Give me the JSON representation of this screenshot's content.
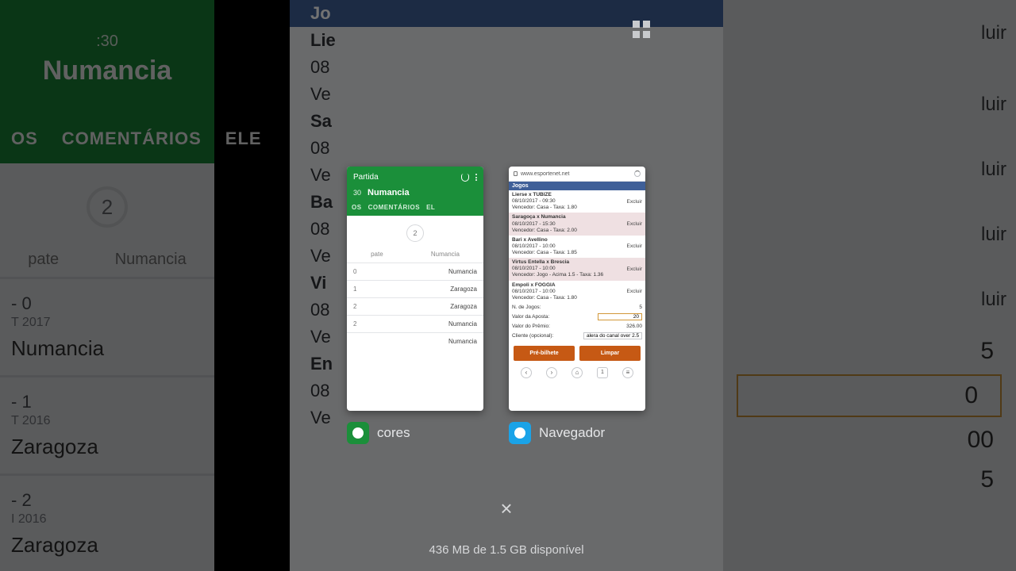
{
  "bg_left": {
    "time_fragment": ":30",
    "team": "Numancia",
    "tabs_fragment_left": "OS",
    "tab_comments": "COMENTÁRIOS",
    "tabs_fragment_right": "ELE",
    "circle_value": "2",
    "sub_label": "pate",
    "team_below": "Numancia",
    "history": [
      {
        "score": "- 0",
        "date": "T 2017",
        "opp": "Numancia"
      },
      {
        "score": "- 1",
        "date": "T 2016",
        "opp": "Zaragoza"
      },
      {
        "score": "- 2",
        "date": "I 2016",
        "opp": "Zaragoza"
      }
    ]
  },
  "bg_center": {
    "rows": [
      {
        "t": "Jo"
      },
      {
        "t": "Lie",
        "d": "08",
        "v": "Ve"
      },
      {
        "t": "Sa",
        "d": "08",
        "v": "Ve"
      },
      {
        "t": "Ba",
        "d": "08",
        "v": "Ve"
      },
      {
        "t": "Vi",
        "d": "08",
        "v": "Ve"
      },
      {
        "t": "En",
        "d": "08",
        "v": "Ve"
      }
    ]
  },
  "bg_right": {
    "rows": [
      {
        "excl": "luir"
      },
      {
        "excl": "luir"
      },
      {
        "excl": "luir"
      },
      {
        "excl": "luir"
      },
      {
        "excl": "luir"
      }
    ],
    "nums": [
      "5",
      "0",
      "00",
      "5"
    ]
  },
  "recents": {
    "apps": [
      {
        "label": "cores"
      },
      {
        "label": "Navegador"
      }
    ],
    "close_label": "×",
    "memory_status": "436 MB de 1.5 GB disponível"
  },
  "cardA": {
    "title": "Partida",
    "score_fragment": "30",
    "team": "Numancia",
    "tab_frag_left": "OS",
    "tab_comments": "COMENTÁRIOS",
    "tab_frag_right": "EL",
    "circle_value": "2",
    "sub_label": "pate",
    "team_below": "Numancia",
    "history": [
      {
        "l": "0",
        "r": "Numancia"
      },
      {
        "l": "1",
        "r": "Zaragoza"
      },
      {
        "l": "2",
        "r": "Zaragoza"
      },
      {
        "l": "2",
        "r": "Numancia"
      },
      {
        "l": " ",
        "r": "Numancia"
      }
    ]
  },
  "cardB": {
    "url": "www.esportenet.net",
    "header": "Jogos",
    "exclude_label": "Excluir",
    "bets": [
      {
        "m": "Lierse x TUBIZE",
        "d": "08/10/2017 - 09:30",
        "v": "Vencedor: Casa - Taxa: 1.80",
        "alt": false
      },
      {
        "m": "Saragoça x Numancia",
        "d": "08/10/2017 - 15:30",
        "v": "Vencedor: Casa - Taxa: 2.00",
        "alt": true
      },
      {
        "m": "Bari x Avellino",
        "d": "08/10/2017 - 10:00",
        "v": "Vencedor: Casa - Taxa: 1.85",
        "alt": false
      },
      {
        "m": "Virtus Entella x Brescia",
        "d": "08/10/2017 - 10:00",
        "v": "Vencedor: Jogo - Acima 1.5 - Taxa: 1.36",
        "alt": true
      },
      {
        "m": "Empoli x FOGGIA",
        "d": "08/10/2017 - 10:00",
        "v": "Vencedor: Casa - Taxa: 1.80",
        "alt": false
      }
    ],
    "summary": {
      "n_jogos_label": "N. de Jogos:",
      "n_jogos_value": "5",
      "valor_aposta_label": "Valor da Aposta:",
      "valor_aposta_value": "20",
      "valor_premio_label": "Valor do Prêmio:",
      "valor_premio_value": "326.00",
      "cliente_label": "Cliente (opcional):",
      "cliente_value": "alera do canal over 2.5"
    },
    "buttons": {
      "pre": "Pré-bilhete",
      "limpar": "Limpar"
    },
    "nav": {
      "back": "‹",
      "fwd": "›",
      "home": "⌂",
      "tabs": "1",
      "menu": "≡"
    }
  }
}
